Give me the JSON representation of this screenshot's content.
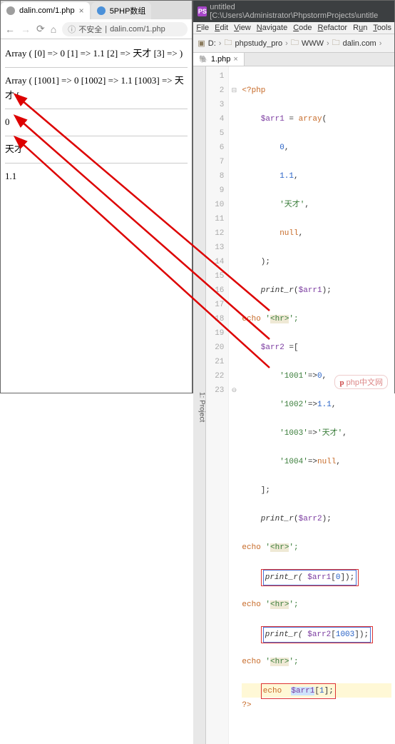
{
  "browser": {
    "tabs": [
      {
        "title": "dalin.com/1.php",
        "favClass": "gray",
        "active": true
      },
      {
        "title": "5PHP数组",
        "favClass": "blue",
        "active": false
      }
    ],
    "addr": {
      "insecure": "不安全",
      "url": "dalin.com/1.php"
    },
    "output": {
      "line1": "Array ( [0] => 0 [1] => 1.1 [2] => 天才 [3] => )",
      "line2": "Array ( [1001] => 0 [1002] => 1.1 [1003] => 天才 [",
      "line3": "0",
      "line4": "天才",
      "line5": "1.1"
    }
  },
  "ide": {
    "title": "untitled [C:\\Users\\Administrator\\PhpstormProjects\\untitle",
    "menu": [
      "File",
      "Edit",
      "View",
      "Navigate",
      "Code",
      "Refactor",
      "Run",
      "Tools"
    ],
    "crumbs": [
      "D:",
      "phpstudy_pro",
      "WWW",
      "dalin.com"
    ],
    "fileTab": "1.php",
    "code": {
      "l1": "<?php",
      "l2_a": "$arr1",
      "l2_b": " = ",
      "l2_c": "array",
      "l2_d": "(",
      "l3": "0",
      "l3_b": ",",
      "l4": "1.1",
      "l4_b": ",",
      "l5": "'天才'",
      "l5_b": ",",
      "l6": "null",
      "l6_b": ",",
      "l7": ");",
      "l8_a": "print_r",
      "l8_b": "(",
      "l8_c": "$arr1",
      "l8_d": ");",
      "l9_a": "echo ",
      "l9_b": "'",
      "l9_tag": "<hr>",
      "l9_c": "';",
      "l10_a": "$arr2",
      "l10_b": " =[",
      "l11_a": "'1001'",
      "l11_b": "=>",
      "l11_c": "0",
      "l11_d": ",",
      "l12_a": "'1002'",
      "l12_b": "=>",
      "l12_c": "1.1",
      "l12_d": ",",
      "l13_a": "'1003'",
      "l13_b": "=>",
      "l13_c": "'天才'",
      "l13_d": ",",
      "l14_a": "'1004'",
      "l14_b": "=>",
      "l14_c": "null",
      "l14_d": ",",
      "l15": "];",
      "l16_a": "print_r",
      "l16_b": "(",
      "l16_c": "$arr2",
      "l16_d": ");",
      "l17_a": "echo ",
      "l17_b": "'",
      "l17_tag": "<hr>",
      "l17_c": "';",
      "l18_a": "print_r( ",
      "l18_b": "$arr1",
      "l18_c": "[",
      "l18_d": "0",
      "l18_e": "]);",
      "l19_a": "echo ",
      "l19_b": "'",
      "l19_tag": "<hr>",
      "l19_c": "';",
      "l20_a": "print_r( ",
      "l20_b": "$arr2",
      "l20_c": "[",
      "l20_d": "1003",
      "l20_e": "]);",
      "l21_a": "echo ",
      "l21_b": "'",
      "l21_tag": "<hr>",
      "l21_c": "';",
      "l22_a": "echo  ",
      "l22_b": "$arr1",
      "l22_c": "[",
      "l22_d": "1",
      "l22_e": "];",
      "l23": "?>"
    }
  },
  "watermark": "php中文网"
}
